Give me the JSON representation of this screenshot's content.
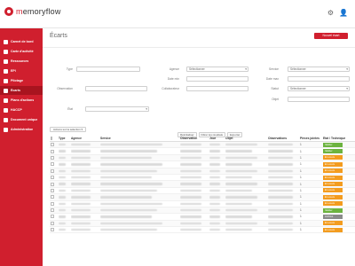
{
  "app": {
    "logo_text_prefix": "m",
    "logo_text_main": "emoryflow",
    "top_icons": [
      "⚙",
      "👤"
    ]
  },
  "sidebar": {
    "items": [
      {
        "label": "Carnet de bord",
        "icon": "dashboard-icon"
      },
      {
        "label": "Carte d'activité",
        "icon": "map-icon"
      },
      {
        "label": "Ressources",
        "icon": "folder-icon"
      },
      {
        "label": "EPI",
        "icon": "helmet-icon"
      },
      {
        "label": "Pilotage",
        "icon": "chart-icon"
      },
      {
        "label": "Écarts",
        "icon": "warning-icon",
        "active": true
      },
      {
        "label": "Plans d'actions",
        "icon": "list-icon"
      },
      {
        "label": "HACCP",
        "icon": "shield-icon"
      },
      {
        "label": "Document unique",
        "icon": "document-icon"
      },
      {
        "label": "Administration",
        "icon": "gear-icon"
      }
    ]
  },
  "page": {
    "title": "Écarts",
    "primary_button": "Nouvel écart"
  },
  "filters": {
    "type_label": "Type",
    "agence_label": "Agence",
    "agence_value": "Sélectionner",
    "service_label": "Service",
    "service_value": "Sélectionner",
    "datemin_label": "Date min",
    "datemax_label": "Date max",
    "observation_label": "Observation",
    "collaborateur_label": "Collaborateur",
    "statut_label": "Statut",
    "statut_value": "Sélectionner",
    "objet_label": "Objet",
    "etat_label": "État",
    "buttons": [
      "Réinitialiser",
      "Filtrer les résultats",
      "Exporter"
    ]
  },
  "table": {
    "bulk_button": "Actions sur la sélection ▾",
    "headers": [
      "Type",
      "Agence",
      "Service",
      "Observation",
      "Jour",
      "Objet",
      "Observations",
      "Pièces jointes",
      "Etat / Technique"
    ],
    "status_colors": {
      "green": "#6cb33f",
      "orange": "#f39c1f",
      "grey": "#8a8a8a"
    },
    "rows": [
      {
        "pieces": "1",
        "status": "Valider",
        "color": "green"
      },
      {
        "pieces": "1",
        "status": "Valider",
        "color": "green"
      },
      {
        "pieces": "1",
        "status": "En cours",
        "color": "orange"
      },
      {
        "pieces": "1",
        "status": "En cours",
        "color": "orange"
      },
      {
        "pieces": "1",
        "status": "En cours",
        "color": "orange"
      },
      {
        "pieces": "1",
        "status": "En cours",
        "color": "orange"
      },
      {
        "pieces": "1",
        "status": "En cours",
        "color": "orange"
      },
      {
        "pieces": "1",
        "status": "En cours",
        "color": "orange"
      },
      {
        "pieces": "1",
        "status": "En cours",
        "color": "orange"
      },
      {
        "pieces": "1",
        "status": "En cours",
        "color": "orange"
      },
      {
        "pieces": "1",
        "status": "Valider",
        "color": "green"
      },
      {
        "pieces": "1",
        "status": "Archivé",
        "color": "grey"
      },
      {
        "pieces": "1",
        "status": "En cours",
        "color": "orange"
      },
      {
        "pieces": "1",
        "status": "En cours",
        "color": "orange"
      }
    ]
  }
}
